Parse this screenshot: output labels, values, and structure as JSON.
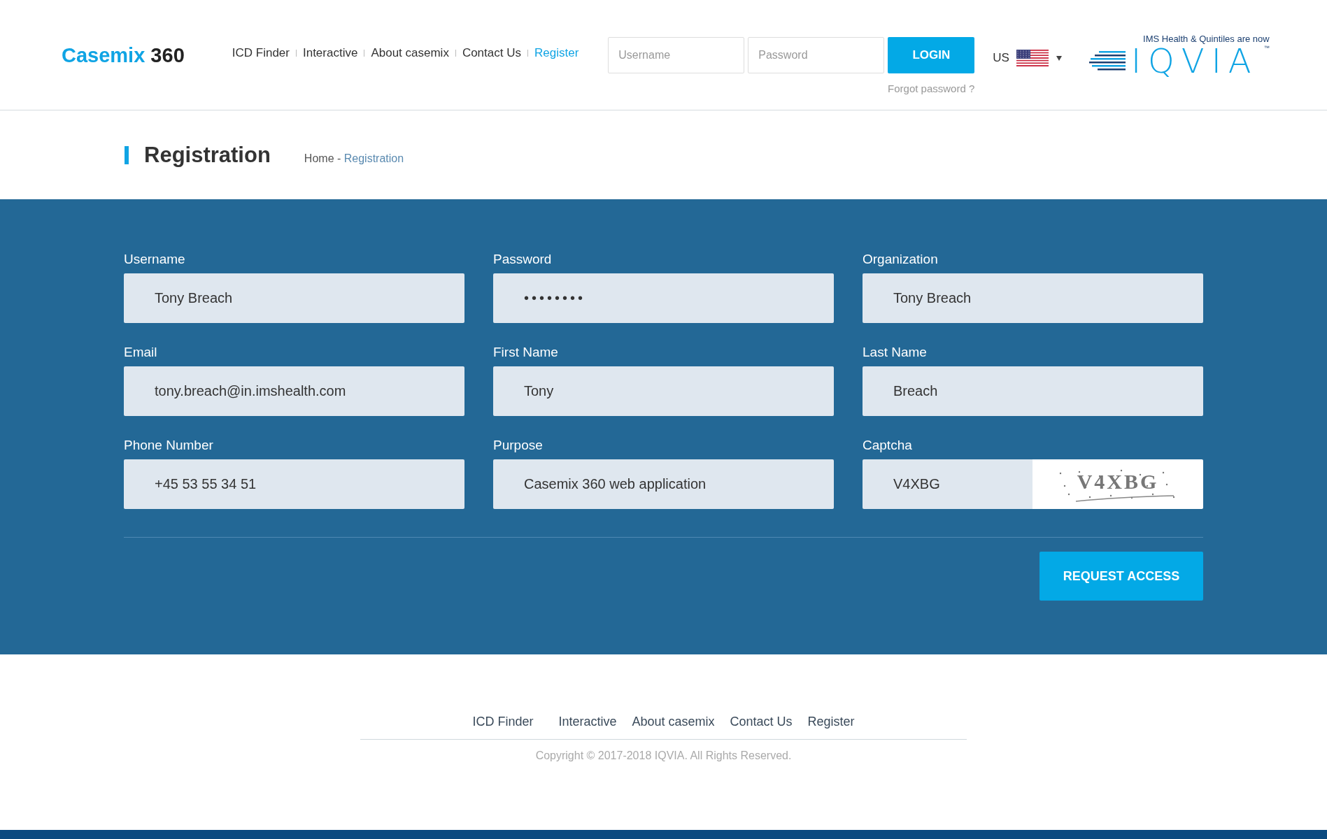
{
  "header": {
    "logo": {
      "brand": "Casemix",
      "number": "360"
    },
    "nav": [
      {
        "label": "ICD Finder",
        "selected": false
      },
      {
        "label": "Interactive",
        "selected": false
      },
      {
        "label": "About casemix",
        "selected": false
      },
      {
        "label": "Contact Us",
        "selected": false
      },
      {
        "label": "Register",
        "selected": true
      }
    ],
    "login": {
      "username_placeholder": "Username",
      "password_placeholder": "Password",
      "button": "LOGIN",
      "forgot": "Forgot password ?"
    },
    "country": "US",
    "partner": {
      "tagline": "IMS Health & Quintiles are now",
      "name": "IQVIA",
      "trademark": "™"
    }
  },
  "page_title": {
    "title": "Registration",
    "breadcrumb": [
      {
        "label": "Home",
        "selected": false
      },
      {
        "label": "Registration",
        "selected": true
      }
    ],
    "separator": "-"
  },
  "form": {
    "fields": [
      {
        "kind": "text",
        "label": "Username",
        "value": "Tony Breach"
      },
      {
        "kind": "text",
        "label": "Password",
        "value": "••••••••"
      },
      {
        "kind": "text",
        "label": "Organization",
        "value": "Tony Breach"
      },
      {
        "kind": "text",
        "label": "Email",
        "value": "tony.breach@in.imshealth.com"
      },
      {
        "kind": "text",
        "label": "First Name",
        "value": "Tony"
      },
      {
        "kind": "text",
        "label": "Last Name",
        "value": "Breach"
      },
      {
        "kind": "text",
        "label": "Phone Number",
        "value": "+45 53 55 34 51"
      },
      {
        "kind": "text",
        "label": "Purpose",
        "value": "Casemix 360 web application"
      },
      {
        "kind": "captcha",
        "label": "Captcha",
        "value": "V4XBG",
        "image_text": "V4XBG"
      }
    ],
    "submit": "REQUEST ACCESS"
  },
  "footer": {
    "links": [
      "ICD Finder",
      "Interactive",
      "About casemix",
      "Contact Us",
      "Register"
    ],
    "copyright": "Copyright © 2017-2018 IQVIA. All Rights Reserved."
  }
}
